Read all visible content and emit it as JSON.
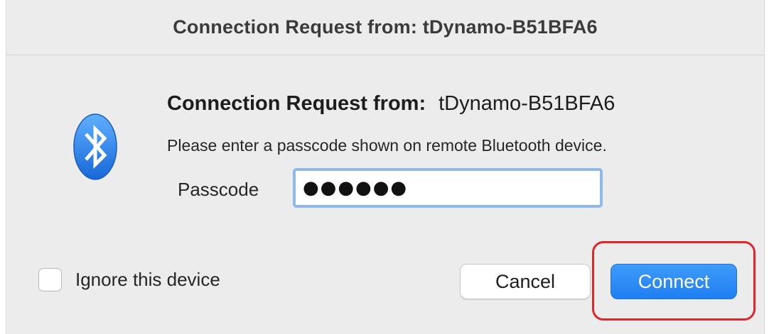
{
  "window": {
    "title": "Connection Request from: tDynamo-B51BFA6"
  },
  "dialog": {
    "heading_label": "Connection Request from:",
    "device_name": "tDynamo-B51BFA6",
    "description": "Please enter a passcode shown on remote Bluetooth device.",
    "passcode_label": "Passcode",
    "passcode_value": "●●●●●●",
    "icon": "bluetooth-icon"
  },
  "footer": {
    "ignore_label": "Ignore this device",
    "ignore_checked": false,
    "cancel_label": "Cancel",
    "connect_label": "Connect"
  },
  "colors": {
    "accent": "#1e7ff2",
    "highlight": "#e0262b",
    "focus_ring": "#8fb8ec"
  }
}
